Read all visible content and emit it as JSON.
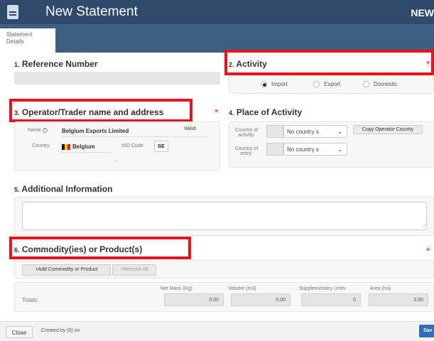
{
  "header": {
    "title": "New Statement",
    "status": "NEW"
  },
  "tabs": [
    {
      "label_line1": "Statement",
      "label_line2": "Details"
    }
  ],
  "reference": {
    "num": "1.",
    "title": "Reference Number",
    "value": ""
  },
  "activity": {
    "num": "2.",
    "title": "Activity",
    "required": "*",
    "options": [
      "Import",
      "Export",
      "Domestic"
    ],
    "selected": "Import"
  },
  "operator": {
    "num": "3.",
    "title": "Operator/Trader name and address",
    "required": "*",
    "name_label": "Name",
    "name_value": "Belgium Exports Limited",
    "valid_text": "Valid",
    "country_label": "Country",
    "country_value": "Belgium",
    "iso_label": "ISO Code",
    "iso_value": "BE",
    "more": "...",
    "flag_colors": [
      "#1a1a1a",
      "#f5c400",
      "#e3202b"
    ]
  },
  "place": {
    "num": "4.",
    "title": "Place of Activity",
    "country_activity_label": "Country of activity:",
    "country_entry_label": "Country of entry:",
    "select_placeholder": "No country s",
    "copy_button": "Copy Operator Country"
  },
  "additional": {
    "num": "5.",
    "title": "Additional Information",
    "value": ""
  },
  "commodity": {
    "num": "6.",
    "title": "Commodity(ies) or Product(s)",
    "required": "*",
    "add_button": "+Add Commodity or Product",
    "remove_button": "×Remove All",
    "totals_label": "Totals:",
    "columns": [
      {
        "header": "Net Mass (Kg)",
        "value": "0.00"
      },
      {
        "header": "Volume (m3)",
        "value": "0.00"
      },
      {
        "header": "Supplementary Units",
        "value": "0"
      },
      {
        "header": "Area (ha)",
        "value": "0.00"
      }
    ]
  },
  "footer": {
    "close_button": "Close",
    "created_text": "Created by (0) on",
    "save_button": "Sav"
  },
  "colors": {
    "header": "#2d4a6a",
    "tabbar": "#3e5f80",
    "highlight": "#e8141c",
    "valid": "#3a8a2a",
    "save": "#2e6fb7"
  }
}
